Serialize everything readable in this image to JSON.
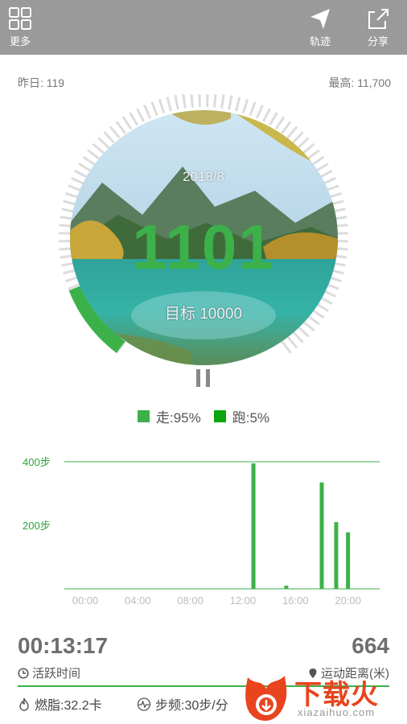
{
  "topbar": {
    "more_label": "更多",
    "track_label": "轨迹",
    "share_label": "分享",
    "background": "#9a9a9a"
  },
  "stats": {
    "yesterday": "昨日: 119",
    "best": "最高: 11,700"
  },
  "dial": {
    "date": "2018/8",
    "steps": "1101",
    "goal": "目标 10000",
    "progress": 0.11,
    "accent": "#3cb149"
  },
  "legend": {
    "walk_label": "走:95%",
    "run_label": "跑:5%",
    "walk_color": "#3cb149",
    "run_color": "#0aa50a"
  },
  "chart_data": {
    "type": "bar",
    "y_tick_labels": [
      "400步",
      "200步"
    ],
    "y_ticks": [
      400,
      200
    ],
    "x_tick_labels": [
      "00:00",
      "04:00",
      "08:00",
      "12:00",
      "16:00",
      "20:00"
    ],
    "x_range": [
      0,
      24
    ],
    "ylim": [
      0,
      400
    ],
    "series": [
      {
        "values": [
          {
            "hour": 12.8,
            "steps": 395
          },
          {
            "hour": 15.3,
            "steps": 10
          },
          {
            "hour": 18.0,
            "steps": 335
          },
          {
            "hour": 19.1,
            "steps": 210
          },
          {
            "hour": 20.0,
            "steps": 178
          }
        ]
      }
    ],
    "bar_color": "#3cb149"
  },
  "summary": {
    "active_time": "00:13:17",
    "active_time_label": "活跃时间",
    "distance": "664",
    "distance_label": "运动距离(米)",
    "fat_burn": "燃脂:32.2卡",
    "cadence": "步频:30步/分"
  },
  "watermark": {
    "cn": "下载火",
    "en": "xiazaihuo.com"
  }
}
